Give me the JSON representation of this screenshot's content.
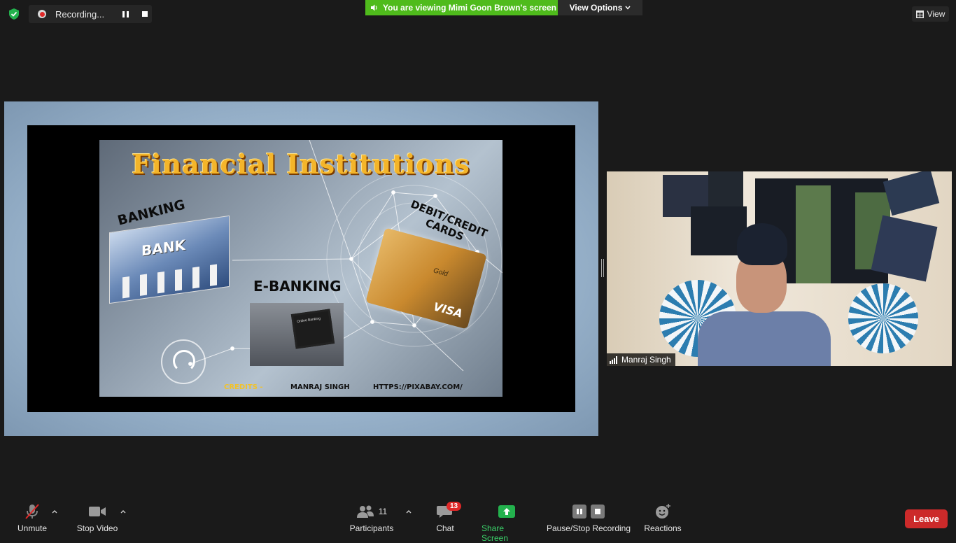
{
  "top": {
    "recording_label": "Recording...",
    "banner_text": "You are viewing Mimi Goon Brown's screen",
    "view_options_label": "View Options",
    "view_label": "View"
  },
  "shared_slide": {
    "title": "Financial Institutions",
    "label_banking": "BANKING",
    "label_debit_line1": "DEBIT/CREDIT",
    "label_debit_line2": "CARDS",
    "label_ebanking": "E-BANKING",
    "bank_sign": "BANK",
    "card_visa": "VISA",
    "card_gold": "Gold",
    "tablet_text": "Online Banking",
    "credits_label": "CREDITS -",
    "credits_name": "MANRAJ SINGH",
    "credits_url": "HTTPS://PIXABAY.COM/"
  },
  "participant": {
    "name": "Manraj Singh"
  },
  "toolbar": {
    "unmute": "Unmute",
    "stop_video": "Stop Video",
    "participants": "Participants",
    "participants_count": "11",
    "chat": "Chat",
    "chat_badge": "13",
    "share_screen": "Share Screen",
    "pause_stop_recording": "Pause/Stop Recording",
    "reactions": "Reactions",
    "leave": "Leave"
  },
  "colors": {
    "banner_green": "#4fbb1c",
    "leave_red": "#cc2a2a",
    "share_green": "#3bd26a",
    "background": "#1a1a1a"
  }
}
